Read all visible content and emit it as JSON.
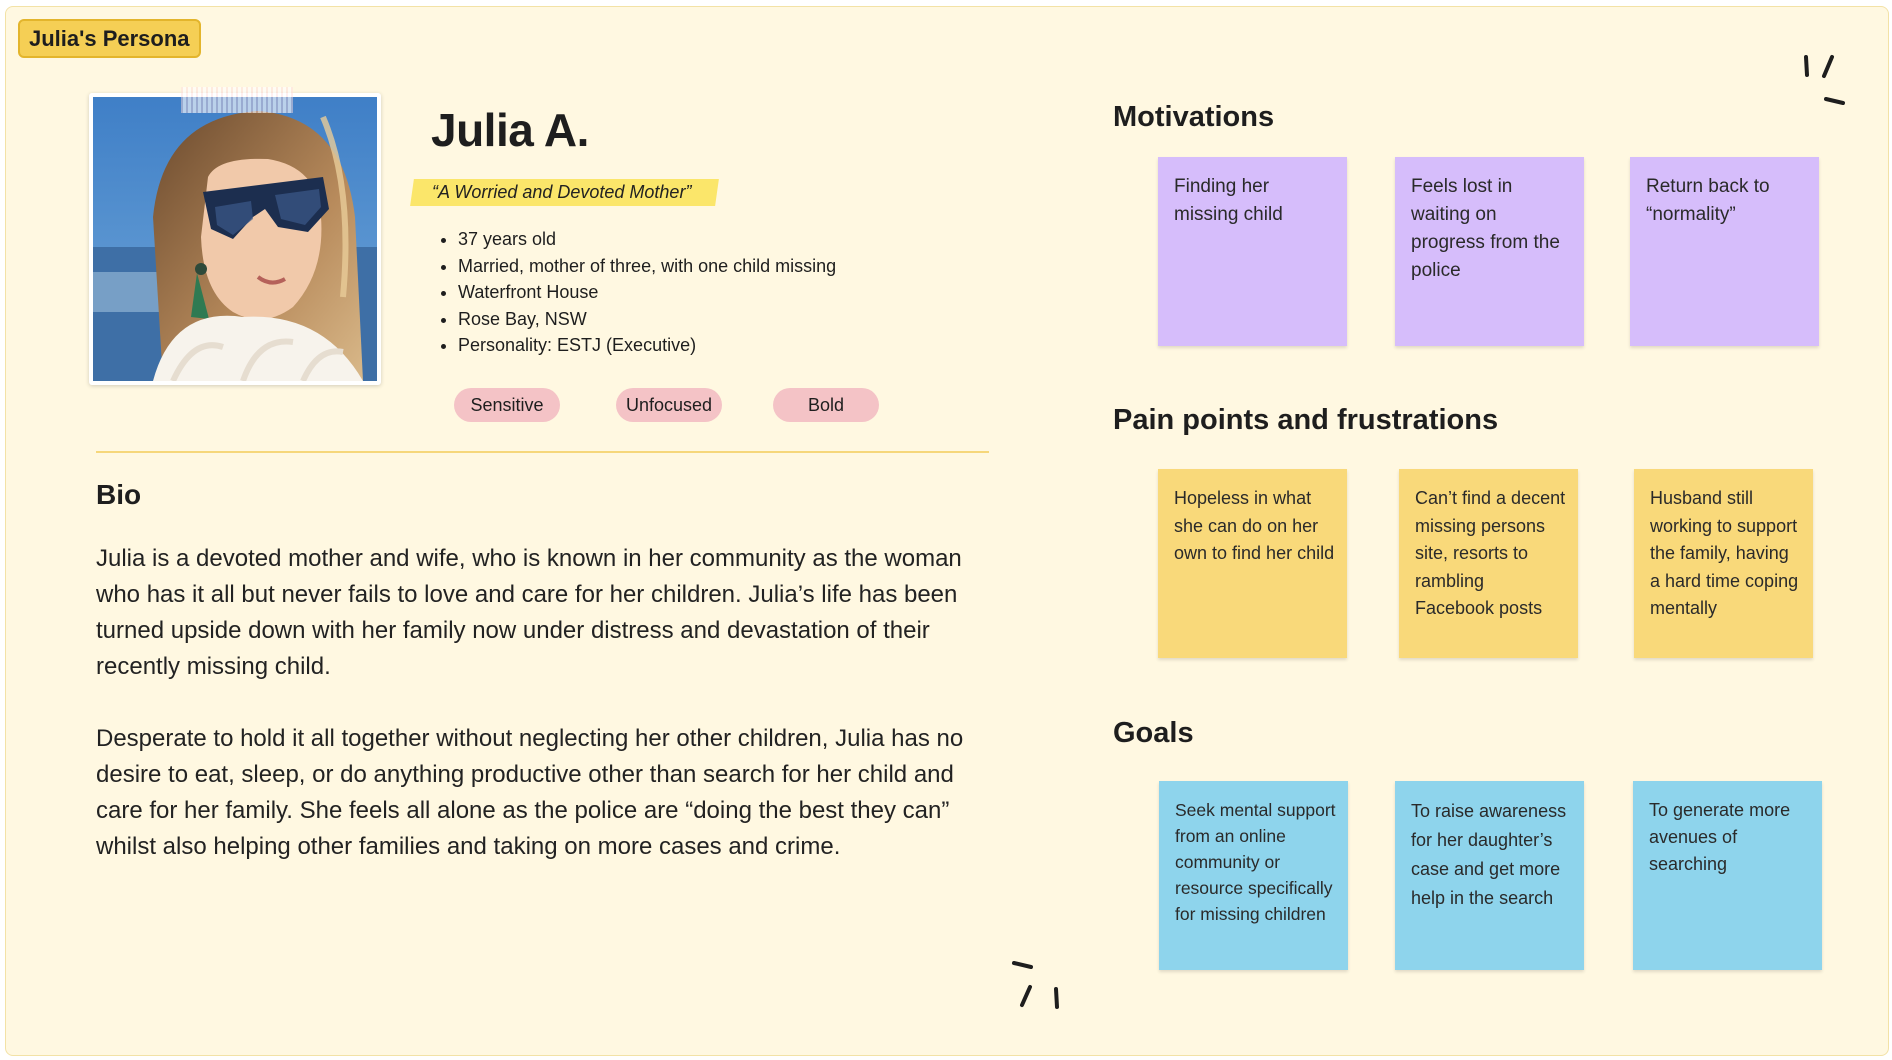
{
  "frame": {
    "label": "Julia's Persona"
  },
  "persona": {
    "name": "Julia A.",
    "tagline": "“A Worried and Devoted Mother”",
    "facts": [
      "37 years old",
      "Married, mother of three, with one child missing",
      "Waterfront House",
      "Rose Bay, NSW",
      "Personality: ESTJ (Executive)"
    ],
    "traits": [
      "Sensitive",
      "Unfocused",
      "Bold"
    ]
  },
  "bio": {
    "title": "Bio",
    "paragraphs": [
      "Julia is a devoted mother and wife, who is known in her community as the woman who has it all but never fails to love and care for her children. Julia’s life has been turned upside down with her family now under distress and devastation of their recently missing child.",
      "Desperate to hold it all together without neglecting her other children, Julia has no desire to eat, sleep, or do anything productive other than search for her child and care for her family. She feels all alone as the police are “doing the best they can” whilst also helping other families and taking on more cases and crime."
    ]
  },
  "motivations": {
    "title": "Motivations",
    "color": "#d6bdfb",
    "notes": [
      "Finding her missing child",
      "Feels lost in waiting on progress from the police",
      "Return back to “normality”"
    ]
  },
  "pain_points": {
    "title": "Pain points and frustrations",
    "color": "#f9d97a",
    "notes": [
      "Hopeless in what she can do on her own to find her child",
      "Can’t find a decent missing persons site, resorts to rambling Facebook posts",
      "Husband still working to support the family, having a hard time coping mentally"
    ]
  },
  "goals": {
    "title": "Goals",
    "color": "#8ed4ec",
    "notes": [
      "Seek mental support from an online community or resource specifically for missing children",
      "To raise awareness for her daughter’s case and get more help in the search",
      "To generate more avenues of searching"
    ]
  }
}
